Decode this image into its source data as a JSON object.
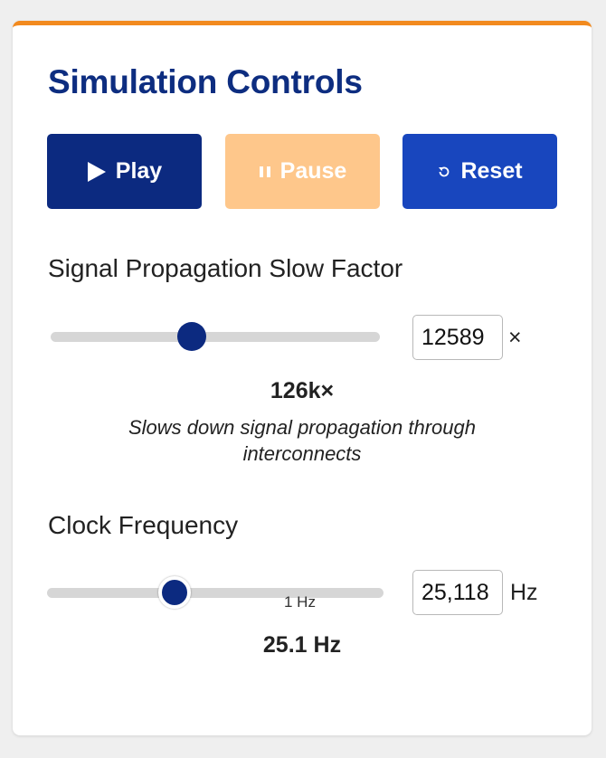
{
  "panel": {
    "title": "Simulation Controls",
    "accent_color": "#f28a1e"
  },
  "buttons": {
    "play": {
      "label": "Play",
      "icon": "play-icon",
      "color": "#0c2a80"
    },
    "pause": {
      "label": "Pause",
      "icon": "pause-icon",
      "color": "#fec78b",
      "state": "disabled"
    },
    "reset": {
      "label": "Reset",
      "icon": "reset-icon",
      "color": "#1846be"
    }
  },
  "slow_factor": {
    "label": "Signal Propagation Slow Factor",
    "input_value": "12589",
    "unit": "×",
    "display": "126k×",
    "help": "Slows down signal propagation through interconnects",
    "slider_fraction": 0.43
  },
  "clock": {
    "label": "Clock Frequency",
    "input_value": "25,118",
    "unit": "Hz",
    "display": "25.1 Hz",
    "tick_label": "1 Hz",
    "slider_fraction": 0.38
  }
}
